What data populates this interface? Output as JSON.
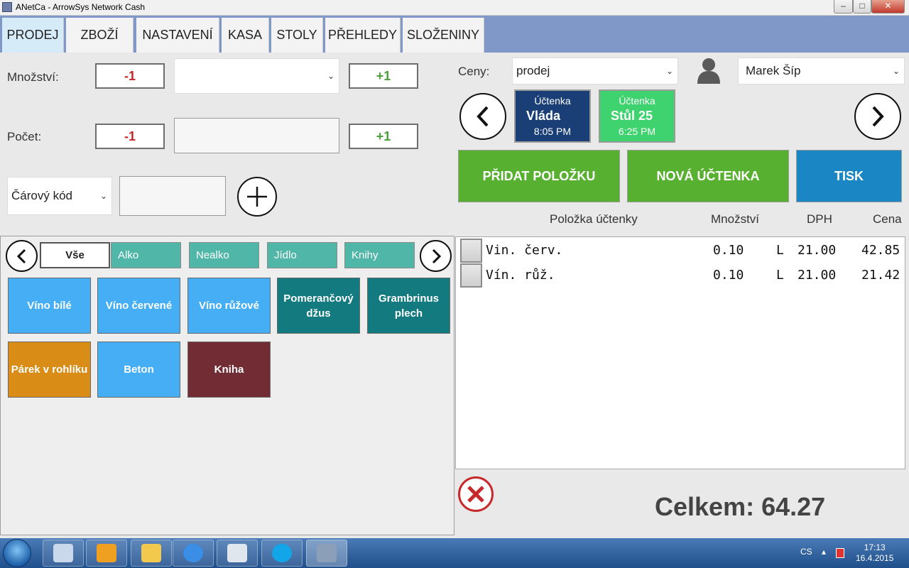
{
  "window": {
    "title": "ANetCa - ArrowSys Network Cash"
  },
  "tabs": [
    "PRODEJ",
    "ZBOŽÍ",
    "NASTAVENÍ",
    "KASA",
    "STOLY",
    "PŘEHLEDY",
    "SLOŽENINY"
  ],
  "left": {
    "quantity_label": "Množství:",
    "count_label": "Počet:",
    "minus": "-1",
    "plus": "+1",
    "barcode_select": "Čárový kód"
  },
  "categories": [
    "Vše",
    "Alko",
    "Nealko",
    "Jídlo",
    "Knihy"
  ],
  "products": [
    {
      "name": "Víno bílé",
      "color": "#45aef5"
    },
    {
      "name": "Víno červené",
      "color": "#45aef5"
    },
    {
      "name": "Víno růžové",
      "color": "#45aef5"
    },
    {
      "name": "Pomerančový džus",
      "color": "#137a7f"
    },
    {
      "name": "Grambrinus plech",
      "color": "#137a7f"
    },
    {
      "name": "Párek v rohlíku",
      "color": "#d98c16"
    },
    {
      "name": "Beton",
      "color": "#45aef5"
    },
    {
      "name": "Kniha",
      "color": "#722d34"
    }
  ],
  "right": {
    "prices_label": "Ceny:",
    "prices_value": "prodej",
    "user_value": "Marek  Šíp",
    "receipts": [
      {
        "label": "Účtenka",
        "name": "Vláda",
        "time": "8:05 PM",
        "color": "#1a3f77"
      },
      {
        "label": "Účtenka",
        "name": "Stůl 25",
        "time": "6:25 PM",
        "color": "#3ed36e"
      }
    ],
    "buttons": {
      "add_item": "PŘIDAT POLOŽKU",
      "new_receipt": "NOVÁ ÚČTENKA",
      "print": "TISK"
    },
    "columns": {
      "item": "Položka účtenky",
      "qty": "Množství",
      "vat": "DPH",
      "price": "Cena"
    },
    "rows": [
      {
        "name": "Vin. červ.",
        "qty": "0.10",
        "unit": "L",
        "vat": "21.00",
        "price": "42.85"
      },
      {
        "name": "Vín. růž.",
        "qty": "0.10",
        "unit": "L",
        "vat": "21.00",
        "price": "21.42"
      }
    ],
    "total": "Celkem: 64.27"
  },
  "taskbar": {
    "lang": "CS",
    "time": "17:13",
    "date": "16.4.2015"
  },
  "colors": {
    "green": "#58b031",
    "blue": "#1a86c4"
  }
}
